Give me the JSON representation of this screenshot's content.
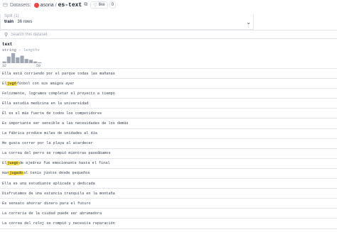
{
  "header": {
    "crumb": "Datasets:",
    "owner": "asoria",
    "slash": "/",
    "dataset": "es-text",
    "like_label": "like",
    "like_count": "0"
  },
  "split": {
    "label": "Split (1)",
    "name": "train",
    "separator": "·",
    "rows": "36 rows"
  },
  "search": {
    "placeholder": "Search this dataset"
  },
  "column": {
    "name": "text",
    "dtype": "string",
    "separator": "·",
    "kind": "lengths",
    "range_min": "32",
    "range_max": "59",
    "bar_color": "#a1a7b3"
  },
  "chart_data": {
    "type": "bar",
    "title": "",
    "xlabel": "lengths",
    "categories": [
      "32-35",
      "35-38",
      "38-41",
      "41-44",
      "44-47",
      "47-50",
      "50-53",
      "53-56",
      "56-59"
    ],
    "values": [
      2,
      8,
      12,
      7,
      9,
      5,
      4,
      2,
      1
    ],
    "xlim": [
      32,
      59
    ]
  },
  "rows": [
    {
      "pre": "Ella está corriendo por el parque todas las mañanas",
      "hl": "",
      "post": ""
    },
    {
      "pre": "El ",
      "hl": "jugó",
      "post": " fútbol con sus amigos ayer"
    },
    {
      "pre": "Felizmente, logramos completar el proyecto a tiempo",
      "hl": "",
      "post": ""
    },
    {
      "pre": "Ella estudia medicina en la universidad",
      "hl": "",
      "post": ""
    },
    {
      "pre": "Él es el más fuerte de todos los competidores",
      "hl": "",
      "post": ""
    },
    {
      "pre": "Es importante ser sensible a las necesidades de los demás",
      "hl": "",
      "post": ""
    },
    {
      "pre": "La fábrica produce miles de unidades al día",
      "hl": "",
      "post": ""
    },
    {
      "pre": "Me gusta correr por la playa al atardecer",
      "hl": "",
      "post": ""
    },
    {
      "pre": "La correa del perro se rompió mientras paseábamos",
      "hl": "",
      "post": ""
    },
    {
      "pre": "El ",
      "hl": "juego",
      "post": " de ajedrez fue emocionante hasta el final"
    },
    {
      "pre": "Han ",
      "hl": "jugado",
      "post": " al tenis juntos desde pequeños"
    },
    {
      "pre": "Ella es una estudiante aplicada y dedicada",
      "hl": "",
      "post": ""
    },
    {
      "pre": "Disfrutamos de una estancia tranquila en la montaña",
      "hl": "",
      "post": ""
    },
    {
      "pre": "Es sensato ahorrar dinero para el futuro",
      "hl": "",
      "post": ""
    },
    {
      "pre": "La correría de la ciudad puede ser abrumadora",
      "hl": "",
      "post": ""
    },
    {
      "pre": "La correa del reloj se rompió y necesita reparación",
      "hl": "",
      "post": ""
    }
  ]
}
